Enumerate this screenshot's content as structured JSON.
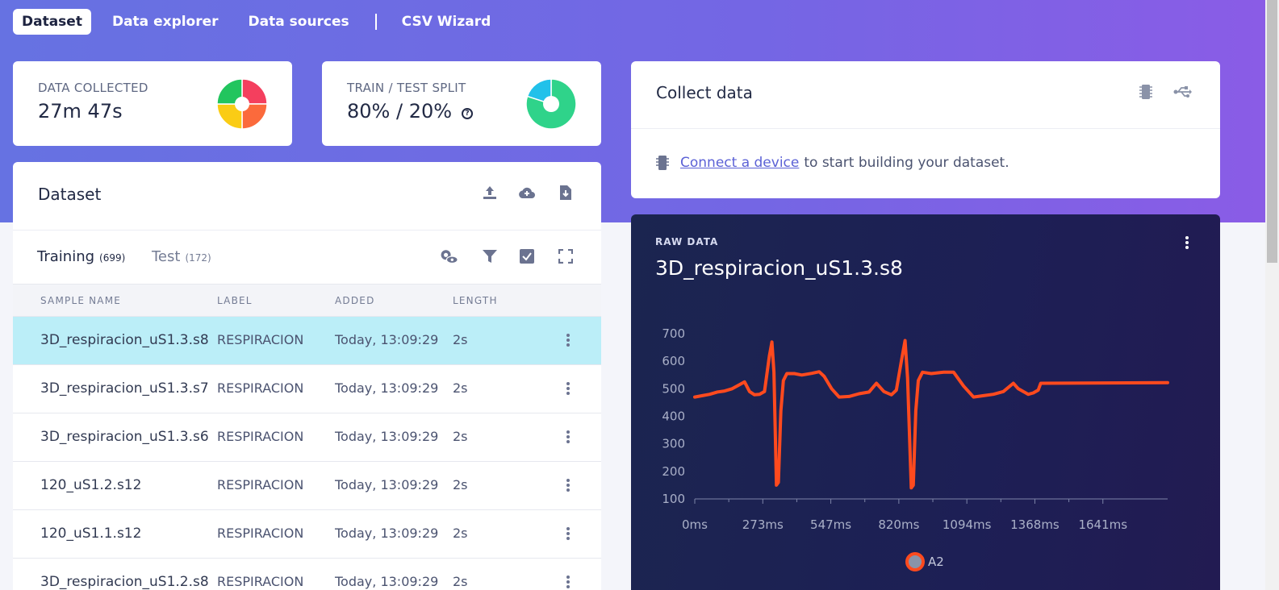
{
  "nav": {
    "tabs": [
      "Dataset",
      "Data explorer",
      "Data sources"
    ],
    "wizard": "CSV Wizard"
  },
  "stats": {
    "collected": {
      "label": "DATA COLLECTED",
      "value": "27m 47s"
    },
    "split": {
      "label": "TRAIN / TEST SPLIT",
      "value": "80% / 20%"
    }
  },
  "dataset": {
    "title": "Dataset",
    "tabs": [
      {
        "label": "Training",
        "count": "(699)"
      },
      {
        "label": "Test",
        "count": "(172)"
      }
    ],
    "columns": [
      "SAMPLE NAME",
      "LABEL",
      "ADDED",
      "LENGTH"
    ],
    "rows": [
      {
        "name": "3D_respiracion_uS1.3.s8",
        "label": "RESPIRACION",
        "added": "Today, 13:09:29",
        "length": "2s"
      },
      {
        "name": "3D_respiracion_uS1.3.s7",
        "label": "RESPIRACION",
        "added": "Today, 13:09:29",
        "length": "2s"
      },
      {
        "name": "3D_respiracion_uS1.3.s6",
        "label": "RESPIRACION",
        "added": "Today, 13:09:29",
        "length": "2s"
      },
      {
        "name": "120_uS1.2.s12",
        "label": "RESPIRACION",
        "added": "Today, 13:09:29",
        "length": "2s"
      },
      {
        "name": "120_uS1.1.s12",
        "label": "RESPIRACION",
        "added": "Today, 13:09:29",
        "length": "2s"
      },
      {
        "name": "3D_respiracion_uS1.2.s8",
        "label": "RESPIRACION",
        "added": "Today, 13:09:29",
        "length": "2s"
      }
    ]
  },
  "collect": {
    "title": "Collect data",
    "link": "Connect a device",
    "text": "to start building your dataset."
  },
  "raw": {
    "label": "RAW DATA",
    "title": "3D_respiracion_uS1.3.s8"
  },
  "chart_data": {
    "type": "line",
    "title": "3D_respiracion_uS1.3.s8",
    "x_ticks": [
      "0ms",
      "273ms",
      "547ms",
      "820ms",
      "1094ms",
      "1368ms",
      "1641ms"
    ],
    "y_ticks": [
      100,
      200,
      300,
      400,
      500,
      600,
      700
    ],
    "ylim": [
      100,
      700
    ],
    "xlim": [
      0,
      1900
    ],
    "series": [
      {
        "name": "A2",
        "color": "#ff4a1e",
        "points": [
          [
            0,
            470
          ],
          [
            30,
            475
          ],
          [
            60,
            480
          ],
          [
            90,
            488
          ],
          [
            120,
            492
          ],
          [
            150,
            500
          ],
          [
            180,
            515
          ],
          [
            200,
            525
          ],
          [
            220,
            490
          ],
          [
            240,
            478
          ],
          [
            260,
            480
          ],
          [
            280,
            490
          ],
          [
            300,
            620
          ],
          [
            310,
            670
          ],
          [
            318,
            560
          ],
          [
            328,
            150
          ],
          [
            336,
            160
          ],
          [
            346,
            420
          ],
          [
            356,
            530
          ],
          [
            370,
            555
          ],
          [
            400,
            555
          ],
          [
            430,
            550
          ],
          [
            470,
            556
          ],
          [
            500,
            562
          ],
          [
            520,
            545
          ],
          [
            550,
            500
          ],
          [
            580,
            470
          ],
          [
            620,
            472
          ],
          [
            660,
            482
          ],
          [
            700,
            488
          ],
          [
            730,
            520
          ],
          [
            760,
            490
          ],
          [
            790,
            478
          ],
          [
            810,
            495
          ],
          [
            830,
            600
          ],
          [
            845,
            675
          ],
          [
            855,
            540
          ],
          [
            870,
            140
          ],
          [
            878,
            150
          ],
          [
            888,
            420
          ],
          [
            898,
            530
          ],
          [
            915,
            560
          ],
          [
            950,
            555
          ],
          [
            1000,
            560
          ],
          [
            1040,
            560
          ],
          [
            1080,
            510
          ],
          [
            1120,
            470
          ],
          [
            1160,
            475
          ],
          [
            1200,
            480
          ],
          [
            1240,
            490
          ],
          [
            1280,
            520
          ],
          [
            1300,
            500
          ],
          [
            1320,
            490
          ],
          [
            1340,
            480
          ],
          [
            1360,
            485
          ],
          [
            1380,
            495
          ],
          [
            1390,
            520
          ],
          [
            1900,
            522
          ]
        ]
      }
    ],
    "grid": false,
    "legend": "bottom-center"
  },
  "colors": {
    "accent": "#6672e2",
    "selected_row": "#bbeef8",
    "series": "#ff4a1e",
    "pie1": [
      "#f43f5e",
      "#fb6a3c",
      "#facc15",
      "#22c55e"
    ],
    "pie2": [
      "#2fd38a",
      "#22c1ea"
    ]
  },
  "donuts": {
    "collected": [
      0.25,
      0.25,
      0.25,
      0.25
    ],
    "split": [
      0.8,
      0.2
    ]
  }
}
